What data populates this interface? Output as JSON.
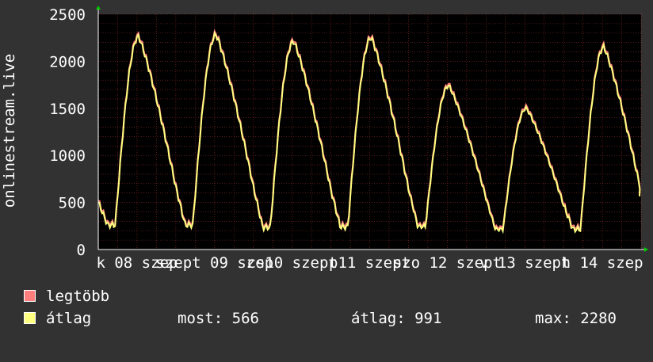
{
  "chart_data": {
    "type": "line",
    "ylabel": "onlinestream.live",
    "ylim": [
      0,
      2500
    ],
    "yticks": [
      0,
      500,
      1000,
      1500,
      2000,
      2500
    ],
    "x_tick_labels": [
      "k 08 szep",
      "szept 09 szep",
      "cs10 szept",
      "p11 szept",
      "szo 12 szept",
      "v 13 szept",
      "h 14 szep"
    ],
    "grid": true,
    "background": "#000000",
    "colors": {
      "max_series": "#ff7f7f",
      "avg_series": "#ffff80",
      "grid": "#d04040",
      "axis_arrow": "#00cc00",
      "frame": "#323232"
    },
    "days": [
      {
        "low": 260,
        "peak": 2260
      },
      {
        "low": 260,
        "peak": 2280
      },
      {
        "low": 235,
        "peak": 2210
      },
      {
        "low": 240,
        "peak": 2250
      },
      {
        "low": 245,
        "peak": 1740
      },
      {
        "low": 215,
        "peak": 1500
      },
      {
        "low": 215,
        "peak": 2150
      }
    ],
    "series": [
      {
        "name": "legtöbb",
        "color": "#ff7f7f"
      },
      {
        "name": "átlag",
        "color": "#ffff80"
      }
    ],
    "start_value": 500,
    "end_value": 566
  },
  "legend": [
    {
      "label": "legtöbb",
      "color": "#ff7f7f"
    },
    {
      "label": "átlag",
      "color": "#ffff80"
    }
  ],
  "stats": {
    "current": "most: 566",
    "average": "átlag: 991",
    "max": "max: 2280"
  }
}
